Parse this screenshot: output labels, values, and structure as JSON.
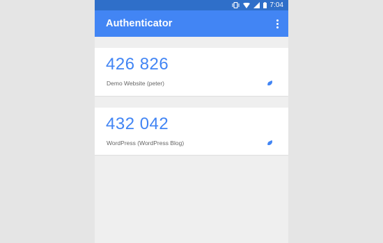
{
  "status_bar": {
    "time": "7:04",
    "icons": [
      "vibrate-icon",
      "wifi-icon",
      "signal-icon",
      "battery-icon"
    ]
  },
  "app_bar": {
    "title": "Authenticator",
    "menu_icon": "more-vert-icon"
  },
  "accounts": [
    {
      "code": "426 826",
      "name": "Demo Website (peter)"
    },
    {
      "code": "432 042",
      "name": "WordPress (WordPress Blog)"
    }
  ],
  "colors": {
    "accent": "#4285f4",
    "status_bar": "#2f6fc9",
    "background": "#efefef"
  }
}
